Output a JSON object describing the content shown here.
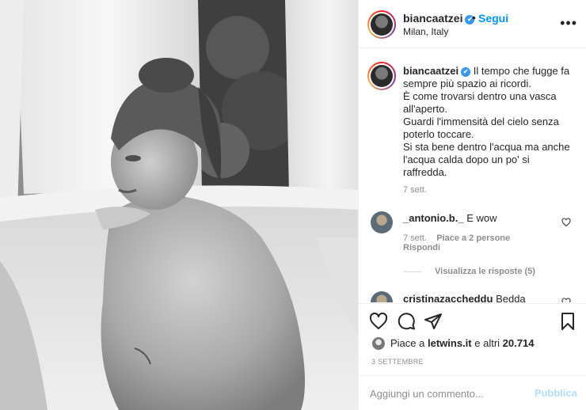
{
  "post": {
    "image_alt": "black and white photo",
    "header": {
      "username": "biancaatzei",
      "dot": "•",
      "follow_label": "Segui",
      "location": "Milan, Italy",
      "more_label": "•••"
    },
    "caption": {
      "username": "biancaatzei",
      "lines": [
        "Il tempo che fugge fa",
        "sempre più spazio ai ricordi.",
        "È come trovarsi dentro una vasca",
        "all'aperto.",
        "Guardi l'immensità del cielo senza",
        "poterlo toccare.",
        "Si sta bene dentro l'acqua ma anche",
        "l'acqua calda dopo un po' si",
        "raffredda."
      ],
      "time": "7 sett."
    },
    "comments": [
      {
        "username": "_antonio.b._",
        "text": "E wow",
        "time": "7 sett.",
        "likes": "Piace a 2 persone",
        "reply_label": "Rispondi",
        "view_replies": "Visualizza le risposte (5)"
      },
      {
        "username": "cristinazaccheddu",
        "text": "Bedda"
      }
    ],
    "likes": {
      "prefix": "Piace a",
      "user": "letwins.it",
      "connector": "e altri",
      "count": "20.714"
    },
    "date": "3 SETTEMBRE",
    "add_comment": {
      "placeholder": "Aggiungi un commento...",
      "publish_label": "Pubblica"
    },
    "icons": {
      "verified": "verified-badge-icon",
      "heart": "heart-icon",
      "comment": "comment-icon",
      "share": "paper-plane-icon",
      "save": "bookmark-icon"
    },
    "colors": {
      "link_blue": "#0095f6",
      "verified_blue": "#3897f0",
      "muted": "#8e8e8e",
      "publish_disabled": "#b2dffc"
    }
  }
}
